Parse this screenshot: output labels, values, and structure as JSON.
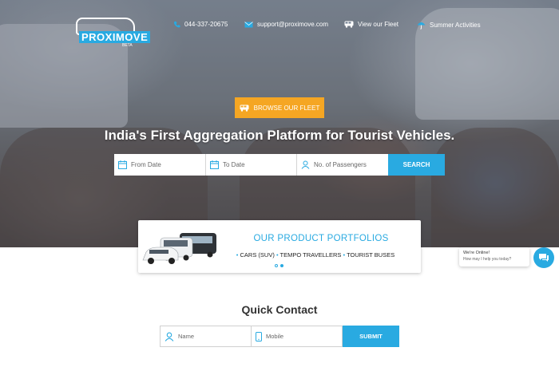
{
  "brand": {
    "logo_text": "PROXIMOVE",
    "beta_label": "BETA",
    "primary_color": "#29aae1",
    "accent_color": "#f5a623"
  },
  "nav": {
    "phone": {
      "icon": "phone-icon",
      "label": "044-337-20675"
    },
    "email": {
      "icon": "envelope-icon",
      "label": "support@proximove.com"
    },
    "fleet": {
      "icon": "bus-icon",
      "label": "View our Fleet"
    },
    "summer": {
      "icon": "umbrella-icon",
      "label": "Summer Activities"
    }
  },
  "hero": {
    "browse_button": "BROWSE OUR FLEET",
    "headline": "India's First Aggregation Platform for Tourist Vehicles."
  },
  "search": {
    "from_placeholder": "From Date",
    "to_placeholder": "To Date",
    "passengers_placeholder": "No. of Passengers",
    "button": "SEARCH"
  },
  "portfolio": {
    "title": "OUR PRODUCT PORTFOLIOS",
    "items": [
      "CARS (SUV)",
      "TEMPO TRAVELLERS",
      "TOURIST BUSES"
    ],
    "slides": 2,
    "active_slide": 2
  },
  "chat": {
    "title": "We're Online!",
    "subtitle": "How may I help you today?"
  },
  "quick_contact": {
    "title": "Quick Contact",
    "name_placeholder": "Name",
    "mobile_placeholder": "Mobile",
    "button": "SUBMIT"
  }
}
